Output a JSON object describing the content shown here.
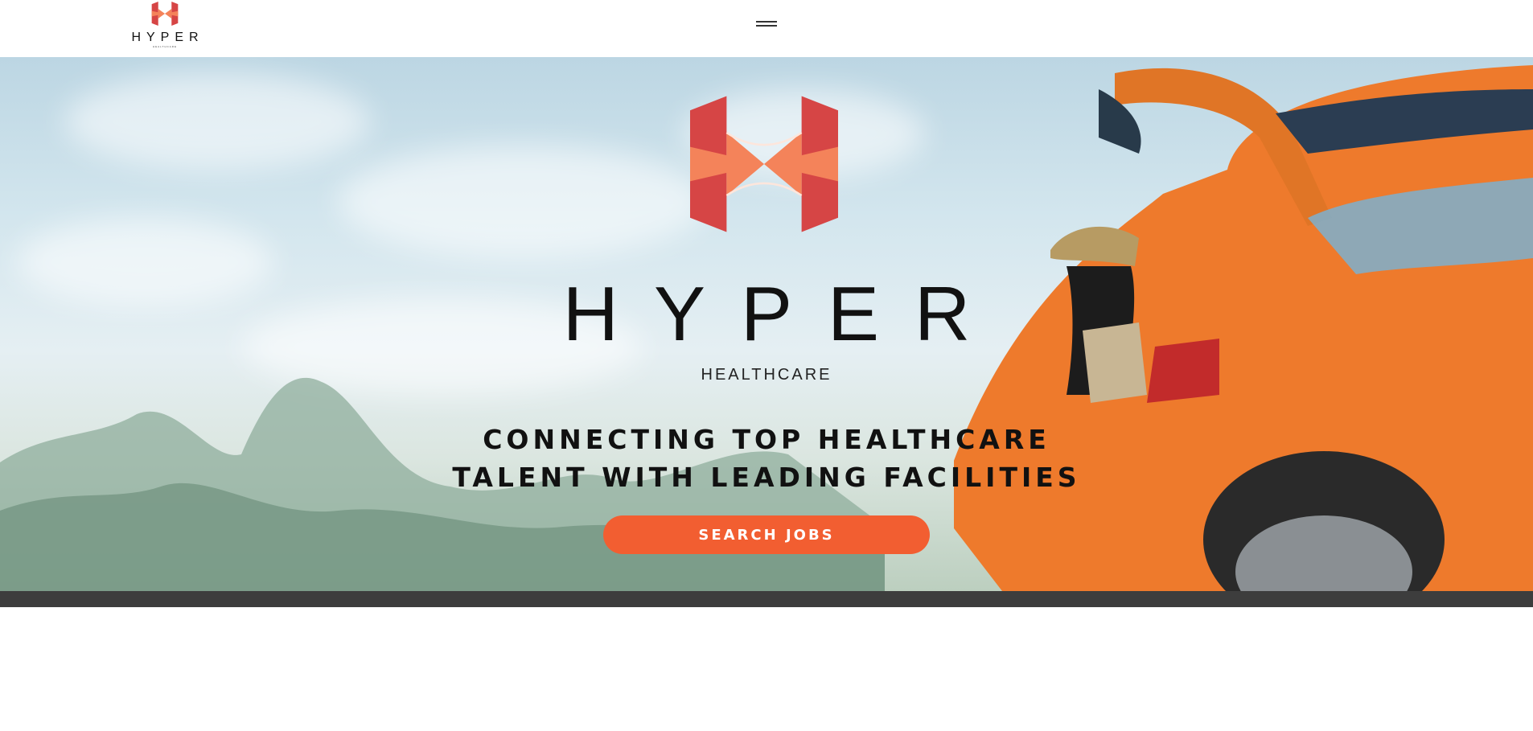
{
  "header": {
    "logo_word": "HYPER",
    "logo_subtext": "HEALTHCARE",
    "menu_icon": "hamburger-menu-icon"
  },
  "hero": {
    "brand_title": "HYPER",
    "brand_subtitle": "HEALTHCARE",
    "tagline_line1": "CONNECTING TOP HEALTHCARE",
    "tagline_line2": "TALENT WITH LEADING FACILITIES",
    "cta_label": "SEARCH JOBS",
    "logo_icon": "hyper-h-logo-icon",
    "background": "mountain-landscape-orange-car-photo"
  },
  "colors": {
    "accent": "#f25e31",
    "logo_dark": "#d64545",
    "logo_light": "#f4835a",
    "band": "#3d3d3d"
  }
}
